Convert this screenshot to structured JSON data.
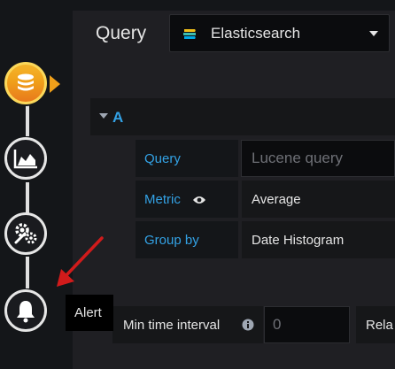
{
  "header": {
    "query_label": "Query",
    "datasource": "Elasticsearch"
  },
  "query": {
    "ref_id": "A",
    "rows": [
      {
        "label": "Query",
        "placeholder": "Lucene query"
      },
      {
        "label": "Metric",
        "value": "Average"
      },
      {
        "label": "Group by",
        "value": "Date Histogram"
      }
    ]
  },
  "options": {
    "min_interval_label": "Min time interval",
    "min_interval_placeholder": "0",
    "relative_label": "Rela"
  },
  "tooltip": "Alert",
  "nav": {
    "steps": [
      {
        "name": "queries",
        "icon": "database-icon",
        "active": true
      },
      {
        "name": "visualization",
        "icon": "area-chart-icon",
        "active": false
      },
      {
        "name": "general",
        "icon": "gears-icon",
        "active": false
      },
      {
        "name": "alert",
        "icon": "bell-icon",
        "active": false
      }
    ]
  },
  "colors": {
    "accent_blue": "#33a2e5",
    "active_orange": "#f0a01a",
    "arrow_red": "#d11b1b",
    "panel_bg": "#1f1f23"
  }
}
